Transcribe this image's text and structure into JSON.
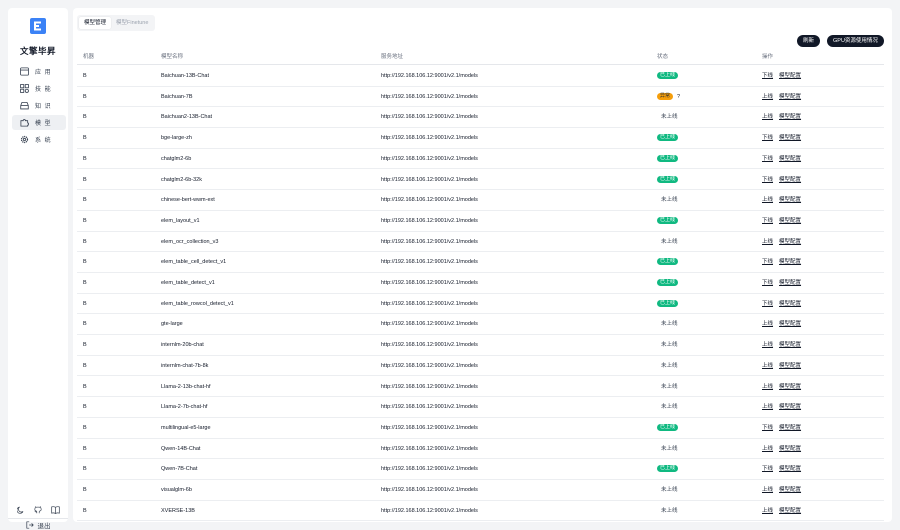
{
  "sidebar": {
    "brand": "文擎毕昇",
    "nav": [
      {
        "label": "应 用",
        "icon": "app-window-icon",
        "active": false
      },
      {
        "label": "技 能",
        "icon": "skill-grid-icon",
        "active": false
      },
      {
        "label": "知 识",
        "icon": "knowledge-box-icon",
        "active": false
      },
      {
        "label": "模 型",
        "icon": "model-puzzle-icon",
        "active": true
      },
      {
        "label": "系 统",
        "icon": "system-gear-icon",
        "active": false
      }
    ],
    "bottom_icons": [
      "moon-icon",
      "github-icon",
      "book-icon"
    ],
    "logout_label": "退出"
  },
  "main": {
    "tabs": [
      {
        "label": "模型管理",
        "active": true
      },
      {
        "label": "模型Finetune",
        "active": false
      }
    ],
    "buttons": {
      "refresh": "刷新",
      "gpu": "GPU资源使用情况"
    },
    "columns": [
      "机器",
      "模型名称",
      "服务地址",
      "状态",
      "操作"
    ],
    "rows": [
      {
        "machine": "B",
        "name": "Baichuan-13B-Chat",
        "url": "http://192.168.106.12:9001/v2.1/models",
        "status": "已上线",
        "status_type": "online",
        "action": "下线",
        "config": "模型配置"
      },
      {
        "machine": "B",
        "name": "Baichuan-7B",
        "url": "http://192.168.106.12:9001/v2.1/models",
        "status": "异常",
        "status_type": "error",
        "extra": "?",
        "action": "上线",
        "config": "模型配置"
      },
      {
        "machine": "B",
        "name": "Baichuan2-13B-Chat",
        "url": "http://192.168.106.12:9001/v2.1/models",
        "status": "未上线",
        "status_type": "offline",
        "action": "上线",
        "config": "模型配置"
      },
      {
        "machine": "B",
        "name": "bge-large-zh",
        "url": "http://192.168.106.12:9001/v2.1/models",
        "status": "已上线",
        "status_type": "online",
        "action": "下线",
        "config": "模型配置"
      },
      {
        "machine": "B",
        "name": "chatglm2-6b",
        "url": "http://192.168.106.12:9001/v2.1/models",
        "status": "已上线",
        "status_type": "online",
        "action": "下线",
        "config": "模型配置"
      },
      {
        "machine": "B",
        "name": "chatglm2-6b-32k",
        "url": "http://192.168.106.12:9001/v2.1/models",
        "status": "已上线",
        "status_type": "online",
        "action": "下线",
        "config": "模型配置"
      },
      {
        "machine": "B",
        "name": "chinese-bert-wwm-ext",
        "url": "http://192.168.106.12:9001/v2.1/models",
        "status": "未上线",
        "status_type": "offline",
        "action": "上线",
        "config": "模型配置"
      },
      {
        "machine": "B",
        "name": "elem_layout_v1",
        "url": "http://192.168.106.12:9001/v2.1/models",
        "status": "已上线",
        "status_type": "online",
        "action": "下线",
        "config": "模型配置"
      },
      {
        "machine": "B",
        "name": "elem_ocr_collection_v3",
        "url": "http://192.168.106.12:9001/v2.1/models",
        "status": "未上线",
        "status_type": "offline",
        "action": "上线",
        "config": "模型配置"
      },
      {
        "machine": "B",
        "name": "elem_table_cell_detect_v1",
        "url": "http://192.168.106.12:9001/v2.1/models",
        "status": "已上线",
        "status_type": "online",
        "action": "下线",
        "config": "模型配置"
      },
      {
        "machine": "B",
        "name": "elem_table_detect_v1",
        "url": "http://192.168.106.12:9001/v2.1/models",
        "status": "已上线",
        "status_type": "online",
        "action": "下线",
        "config": "模型配置"
      },
      {
        "machine": "B",
        "name": "elem_table_rowcol_detect_v1",
        "url": "http://192.168.106.12:9001/v2.1/models",
        "status": "已上线",
        "status_type": "online",
        "action": "下线",
        "config": "模型配置"
      },
      {
        "machine": "B",
        "name": "gte-large",
        "url": "http://192.168.106.12:9001/v2.1/models",
        "status": "未上线",
        "status_type": "offline",
        "action": "上线",
        "config": "模型配置"
      },
      {
        "machine": "B",
        "name": "internlm-20b-chat",
        "url": "http://192.168.106.12:9001/v2.1/models",
        "status": "未上线",
        "status_type": "offline",
        "action": "上线",
        "config": "模型配置"
      },
      {
        "machine": "B",
        "name": "internlm-chat-7b-8k",
        "url": "http://192.168.106.12:9001/v2.1/models",
        "status": "未上线",
        "status_type": "offline",
        "action": "上线",
        "config": "模型配置"
      },
      {
        "machine": "B",
        "name": "Llama-2-13b-chat-hf",
        "url": "http://192.168.106.12:9001/v2.1/models",
        "status": "未上线",
        "status_type": "offline",
        "action": "上线",
        "config": "模型配置"
      },
      {
        "machine": "B",
        "name": "Llama-2-7b-chat-hf",
        "url": "http://192.168.106.12:9001/v2.1/models",
        "status": "未上线",
        "status_type": "offline",
        "action": "上线",
        "config": "模型配置"
      },
      {
        "machine": "B",
        "name": "multilingual-e5-large",
        "url": "http://192.168.106.12:9001/v2.1/models",
        "status": "已上线",
        "status_type": "online",
        "action": "下线",
        "config": "模型配置"
      },
      {
        "machine": "B",
        "name": "Qwen-14B-Chat",
        "url": "http://192.168.106.12:9001/v2.1/models",
        "status": "未上线",
        "status_type": "offline",
        "action": "上线",
        "config": "模型配置"
      },
      {
        "machine": "B",
        "name": "Qwen-7B-Chat",
        "url": "http://192.168.106.12:9001/v2.1/models",
        "status": "已上线",
        "status_type": "online",
        "action": "下线",
        "config": "模型配置"
      },
      {
        "machine": "B",
        "name": "visualglm-6b",
        "url": "http://192.168.106.12:9001/v2.1/models",
        "status": "未上线",
        "status_type": "offline",
        "action": "上线",
        "config": "模型配置"
      },
      {
        "machine": "B",
        "name": "XVERSE-13B",
        "url": "http://192.168.106.12:9001/v2.1/models",
        "status": "未上线",
        "status_type": "offline",
        "action": "上线",
        "config": "模型配置"
      }
    ]
  },
  "colors": {
    "online": "#10b981",
    "error": "#f59e0b",
    "brand": "#3b82f6",
    "dark_button": "#111827"
  }
}
